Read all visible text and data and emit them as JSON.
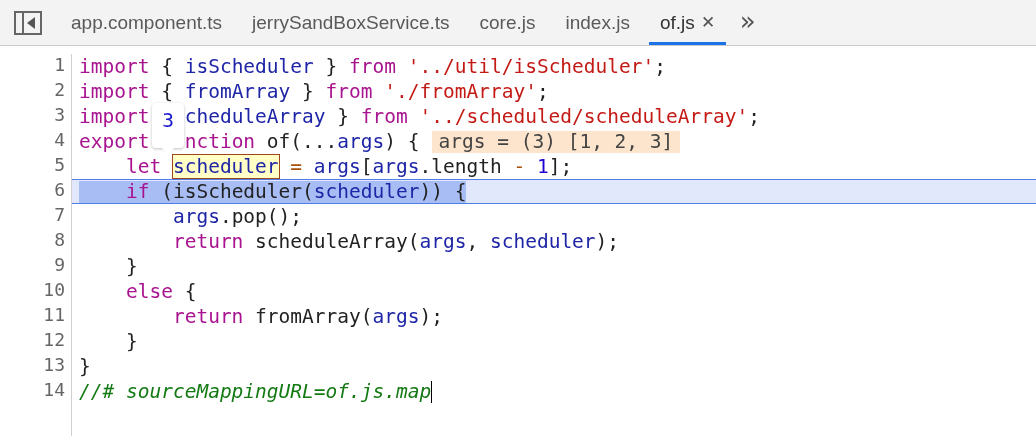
{
  "tabs": [
    {
      "label": "app.component.ts",
      "selected": false,
      "closable": false
    },
    {
      "label": "jerrySandBoxService.ts",
      "selected": false,
      "closable": false
    },
    {
      "label": "core.js",
      "selected": false,
      "closable": false
    },
    {
      "label": "index.js",
      "selected": false,
      "closable": false
    },
    {
      "label": "of.js",
      "selected": true,
      "closable": true
    }
  ],
  "close_glyph": "✕",
  "overflow_glyph": "»",
  "tooltip": {
    "value": "3"
  },
  "lines": [
    {
      "number": "1",
      "active": false,
      "cursor": false,
      "tokens": [
        {
          "kind": "kw",
          "t": "import "
        },
        {
          "kind": "plain",
          "t": "{ "
        },
        {
          "kind": "var",
          "t": "isScheduler "
        },
        {
          "kind": "plain",
          "t": "} "
        },
        {
          "kind": "kw",
          "t": "from "
        },
        {
          "kind": "str",
          "t": "'../util/isScheduler'"
        },
        {
          "kind": "plain",
          "t": ";"
        }
      ]
    },
    {
      "number": "2",
      "active": false,
      "cursor": false,
      "tokens": [
        {
          "kind": "kw",
          "t": "import "
        },
        {
          "kind": "plain",
          "t": "{ "
        },
        {
          "kind": "var",
          "t": "fromArray "
        },
        {
          "kind": "plain",
          "t": "} "
        },
        {
          "kind": "kw",
          "t": "from "
        },
        {
          "kind": "str",
          "t": "'./fromArray'"
        },
        {
          "kind": "plain",
          "t": ";"
        }
      ]
    },
    {
      "number": "3",
      "active": false,
      "cursor": false,
      "tokens": [
        {
          "kind": "kw",
          "t": "import"
        },
        {
          "kind": "var",
          "t": "cheduleArray ",
          "after_tooltip": true
        },
        {
          "kind": "plain",
          "t": "} "
        },
        {
          "kind": "kw",
          "t": "from "
        },
        {
          "kind": "str",
          "t": "'../scheduled/scheduleArray'"
        },
        {
          "kind": "plain",
          "t": ";"
        }
      ]
    },
    {
      "number": "4",
      "active": false,
      "cursor": false,
      "inline_value": "args = (3) [1, 2, 3]",
      "tokens": [
        {
          "kind": "kw",
          "t": "export"
        },
        {
          "kind": "kw",
          "t": "nction ",
          "after_tooltip": true
        },
        {
          "kind": "plain",
          "t": "of(..."
        },
        {
          "kind": "var",
          "t": "args"
        },
        {
          "kind": "plain",
          "t": ") {"
        }
      ]
    },
    {
      "number": "5",
      "active": false,
      "cursor": false,
      "tokens": [
        {
          "kind": "kw",
          "t": "    let "
        },
        {
          "kind": "var",
          "t": "scheduler",
          "hover": true
        },
        {
          "kind": "op",
          "t": " = "
        },
        {
          "kind": "var",
          "t": "args"
        },
        {
          "kind": "plain",
          "t": "["
        },
        {
          "kind": "var",
          "t": "args"
        },
        {
          "kind": "plain",
          "t": ".length "
        },
        {
          "kind": "op",
          "t": "- "
        },
        {
          "kind": "num",
          "t": "1"
        },
        {
          "kind": "plain",
          "t": "];"
        }
      ]
    },
    {
      "number": "6",
      "active": true,
      "cursor": false,
      "tokens": [
        {
          "kind": "kw",
          "t": "    if "
        },
        {
          "kind": "plain",
          "t": "(isScheduler("
        },
        {
          "kind": "var",
          "t": "scheduler"
        },
        {
          "kind": "plain",
          "t": ")) {"
        }
      ]
    },
    {
      "number": "7",
      "active": false,
      "cursor": false,
      "tokens": [
        {
          "kind": "var",
          "t": "        args"
        },
        {
          "kind": "plain",
          "t": ".pop();"
        }
      ]
    },
    {
      "number": "8",
      "active": false,
      "cursor": false,
      "tokens": [
        {
          "kind": "kw",
          "t": "        return "
        },
        {
          "kind": "plain",
          "t": "scheduleArray("
        },
        {
          "kind": "var",
          "t": "args"
        },
        {
          "kind": "plain",
          "t": ", "
        },
        {
          "kind": "var",
          "t": "scheduler"
        },
        {
          "kind": "plain",
          "t": ");"
        }
      ]
    },
    {
      "number": "9",
      "active": false,
      "cursor": false,
      "tokens": [
        {
          "kind": "plain",
          "t": "    }"
        }
      ]
    },
    {
      "number": "10",
      "active": false,
      "cursor": false,
      "tokens": [
        {
          "kind": "kw",
          "t": "    else "
        },
        {
          "kind": "plain",
          "t": "{"
        }
      ]
    },
    {
      "number": "11",
      "active": false,
      "cursor": false,
      "tokens": [
        {
          "kind": "kw",
          "t": "        return "
        },
        {
          "kind": "plain",
          "t": "fromArray("
        },
        {
          "kind": "var",
          "t": "args"
        },
        {
          "kind": "plain",
          "t": ");"
        }
      ]
    },
    {
      "number": "12",
      "active": false,
      "cursor": false,
      "tokens": [
        {
          "kind": "plain",
          "t": "    }"
        }
      ]
    },
    {
      "number": "13",
      "active": false,
      "cursor": false,
      "tokens": [
        {
          "kind": "plain",
          "t": "}"
        }
      ]
    },
    {
      "number": "14",
      "active": false,
      "cursor": true,
      "tokens": [
        {
          "kind": "comment",
          "t": "//# sourceMappingURL=of.js.map"
        }
      ]
    }
  ]
}
